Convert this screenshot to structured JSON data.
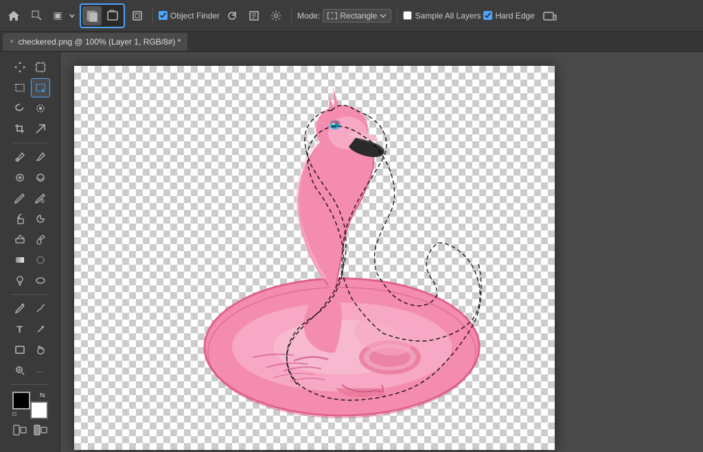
{
  "toolbar": {
    "object_finder_label": "Object Finder",
    "mode_label": "Mode:",
    "mode_value": "Rectangle",
    "sample_all_layers_label": "Sample All Layers",
    "hard_edge_label": "Hard Edge",
    "hard_edge_checked": true,
    "sample_all_layers_checked": false
  },
  "tab": {
    "title": "checkered.png @ 100% (Layer 1, RGB/8#) *",
    "close": "×"
  },
  "tools": {
    "move": "✥",
    "marquee_rect": "⬚",
    "lasso": "⌓",
    "object_select": "⬚",
    "crop": "⊹",
    "slice": "✂",
    "eyedropper": "⊘",
    "healing": "⊕",
    "brush": "⌀",
    "clone": "⊕",
    "history": "⊗",
    "eraser": "⊡",
    "gradient": "▣",
    "blur": "⊙",
    "dodge": "◎",
    "pen": "✒",
    "text": "T",
    "path_select": "▶",
    "rect_shape": "⬛",
    "hand": "✋",
    "zoom": "🔍",
    "extra": "…"
  },
  "colors": {
    "foreground": "#000000",
    "background": "#ffffff",
    "toolbar_bg": "#3c3c3c",
    "canvas_bg": "#4a4a4a",
    "tab_bg": "#4a4a4a",
    "selection_border": "#000000",
    "active_tool_border": "#4da6ff"
  }
}
